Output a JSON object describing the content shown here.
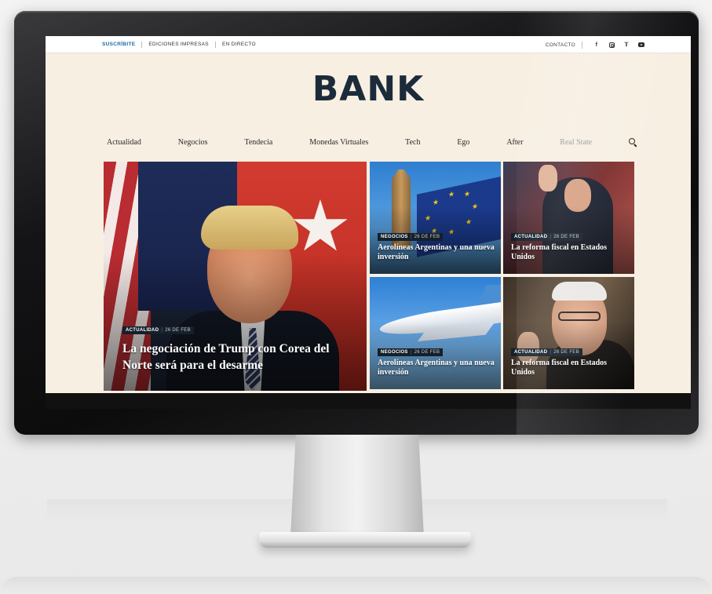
{
  "topbar": {
    "links": [
      "SUSCRÍBITE",
      "EDICIONES IMPRESAS",
      "EN DIRECTO"
    ],
    "contact": "CONTACTO",
    "social": [
      {
        "icon": "facebook-icon",
        "glyph": "f"
      },
      {
        "icon": "instagram-icon",
        "glyph": ""
      },
      {
        "icon": "twitter-icon",
        "glyph": "t"
      },
      {
        "icon": "youtube-icon",
        "glyph": ""
      }
    ]
  },
  "logo": "BANK",
  "nav": {
    "items": [
      "Actualidad",
      "Negocios",
      "Tendecia",
      "Monedas Virtuales",
      "Tech",
      "Ego",
      "After",
      "Real State"
    ]
  },
  "cards": {
    "main": {
      "category": "ACTUALIDAD",
      "date": "26 DE FEB",
      "headline": "La negociación de Trump con Corea del Norte será para el desarme"
    },
    "c1": {
      "category": "NEGOCIOS",
      "date": "26 DE FEB",
      "headline": "Aerolíneas Argentinas y una nueva inversión"
    },
    "c2": {
      "category": "ACTUALIDAD",
      "date": "26 DE FEB",
      "headline": "La reforma fiscal en Estados Unidos"
    },
    "c3": {
      "category": "NEGOCIOS",
      "date": "26 DE FEB",
      "headline": "Aerolíneas Argentinas y una nueva inversión"
    },
    "c4": {
      "category": "ACTUALIDAD",
      "date": "26 DE FEB",
      "headline": "La reforma fiscal en Estados Unidos"
    }
  },
  "colors": {
    "page_bg": "#f7efe2",
    "logo": "#1c2b3a",
    "accent_link": "#1a6aa8",
    "tag_bg": "#14202b"
  }
}
